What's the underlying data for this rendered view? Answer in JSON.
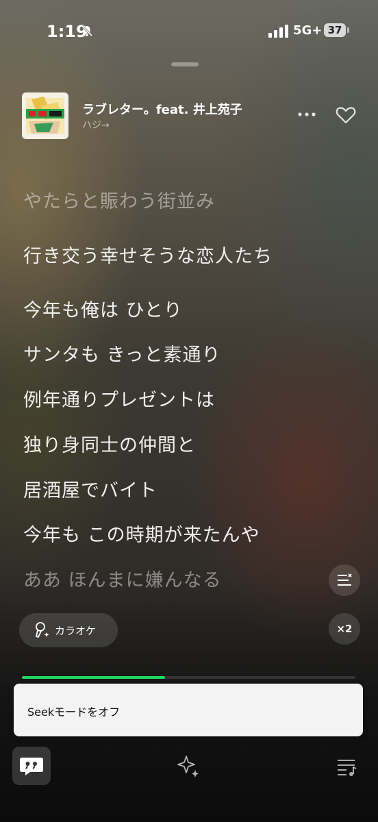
{
  "status_bar": {
    "time": "1:19",
    "network": "5G+",
    "battery": "37"
  },
  "now_playing": {
    "title": "ラブレター。feat. 井上苑子",
    "artist": "ハジ→"
  },
  "lyrics": [
    "やたらと賑わう街並み",
    "行き交う幸せそうな恋人たち",
    "今年も俺は ひとり",
    "サンタも きっと素通り",
    "例年通りプレゼントは",
    "独り身同士の仲間と",
    "居酒屋でバイト",
    "今年も この時期が来たんや",
    "ああ ほんまに嫌んなる"
  ],
  "controls": {
    "karaoke_label": "カラオケ",
    "speed_label": "×2"
  },
  "playback": {
    "progress": 0.43,
    "accent": "#1ed760"
  },
  "toast": {
    "text": "Seekモードをオフ"
  },
  "bottom_tabs": [
    "lyrics-quote-icon",
    "sparkle-icon",
    "queue-icon"
  ]
}
